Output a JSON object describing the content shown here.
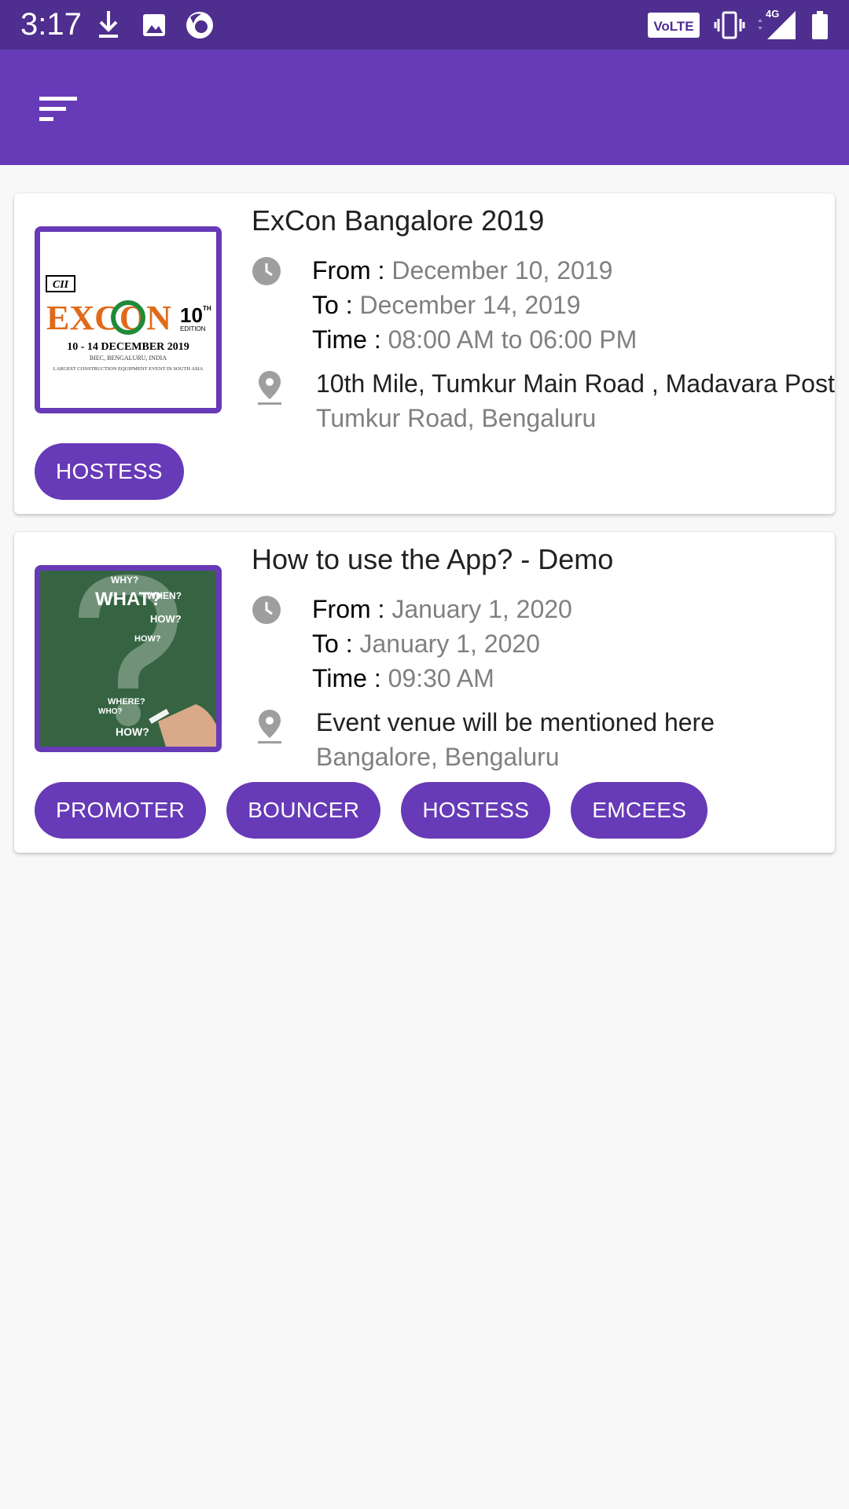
{
  "status_bar": {
    "time": "3:17",
    "icons_left": [
      "download-icon",
      "image-icon",
      "firefox-icon"
    ],
    "volte_label": "VoLTE",
    "network_label": "4G",
    "icons_right": [
      "volte-icon",
      "vibrate-icon",
      "signal-icon",
      "battery-icon"
    ]
  },
  "app_bar": {
    "menu_icon": "sort-menu-icon",
    "color": "#673ab7"
  },
  "colors": {
    "accent": "#673ab7",
    "status_bar": "#4e2e8e",
    "background": "#f8f8f8"
  },
  "events": [
    {
      "title": "ExCon Bangalore 2019",
      "from_label": "From :",
      "from": "December 10, 2019",
      "to_label": "To :",
      "to": "December 14, 2019",
      "time_label": "Time :",
      "time": "08:00 AM to 06:00 PM",
      "venue_line1": "10th Mile, Tumkur Main Road , Madavara Post",
      "venue_line2": "Tumkur Road, Bengaluru",
      "thumb": {
        "cii": "CII",
        "brand": "EXCON",
        "edition": "10",
        "edition_sup": "TH",
        "edition_word": "EDITION",
        "dates": "10 - 14 DECEMBER 2019",
        "place": "BIEC, BENGALURU, INDIA",
        "tagline": "LARGEST CONSTRUCTION EQUIPMENT EVENT IN SOUTH ASIA"
      },
      "roles": [
        "HOSTESS"
      ]
    },
    {
      "title": "How to use the App? - Demo",
      "from_label": "From :",
      "from": "January 1, 2020",
      "to_label": "To :",
      "to": "January 1, 2020",
      "time_label": "Time :",
      "time": "09:30 AM",
      "venue_line1": "Event venue will be mentioned here",
      "venue_line2": "Bangalore, Bengaluru",
      "thumb": {
        "words": [
          "WHY?",
          "WHAT?",
          "WHEN?",
          "HOW?",
          "WHERE?",
          "WHO?"
        ]
      },
      "roles": [
        "PROMOTER",
        "BOUNCER",
        "HOSTESS",
        "EMCEES"
      ]
    }
  ]
}
